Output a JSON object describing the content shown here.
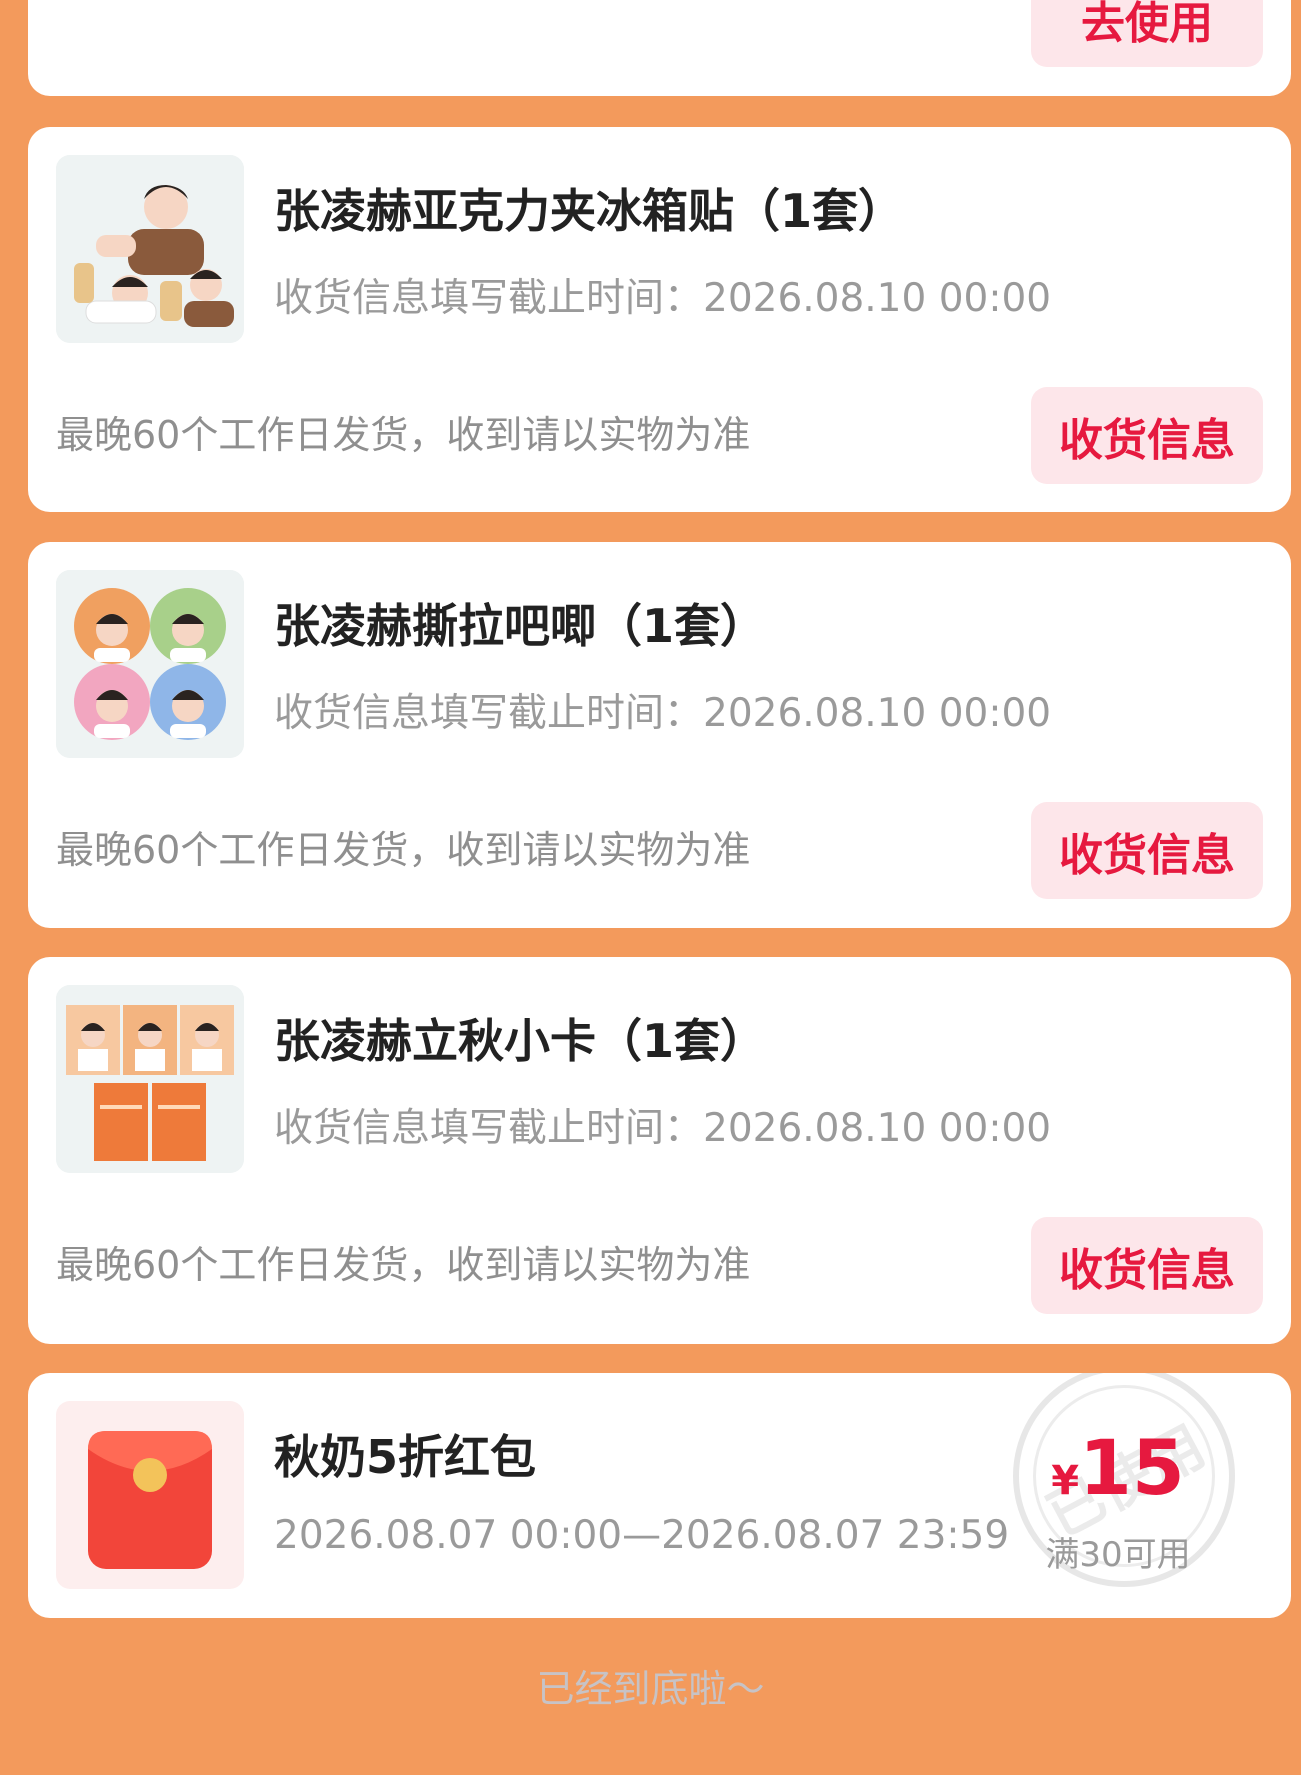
{
  "top_card": {
    "button_label": "去使用"
  },
  "items": [
    {
      "title": "张凌赫亚克力夹冰箱贴（1套）",
      "deadline": "收货信息填写截止时间：2026.08.10 00:00",
      "note": "最晚60个工作日发货，收到请以实物为准",
      "button_label": "收货信息",
      "image": "acrylic-magnet-product-image"
    },
    {
      "title": "张凌赫撕拉吧唧（1套）",
      "deadline": "收货信息填写截止时间：2026.08.10 00:00",
      "note": "最晚60个工作日发货，收到请以实物为准",
      "button_label": "收货信息",
      "image": "badge-set-product-image"
    },
    {
      "title": "张凌赫立秋小卡（1套）",
      "deadline": "收货信息填写截止时间：2026.08.10 00:00",
      "note": "最晚60个工作日发货，收到请以实物为准",
      "button_label": "收货信息",
      "image": "photo-card-set-product-image"
    }
  ],
  "coupon": {
    "title": "秋奶5折红包",
    "validity": "2026.08.07 00:00—2026.08.07 23:59",
    "currency": "¥",
    "amount": "15",
    "condition": "满30可用",
    "stamp": "已使用",
    "icon": "red-packet-icon"
  },
  "footer": {
    "end_text": "已经到底啦～"
  },
  "colors": {
    "background": "#f39a5c",
    "accent_red": "#e6193f",
    "button_bg": "#fde6ea"
  }
}
